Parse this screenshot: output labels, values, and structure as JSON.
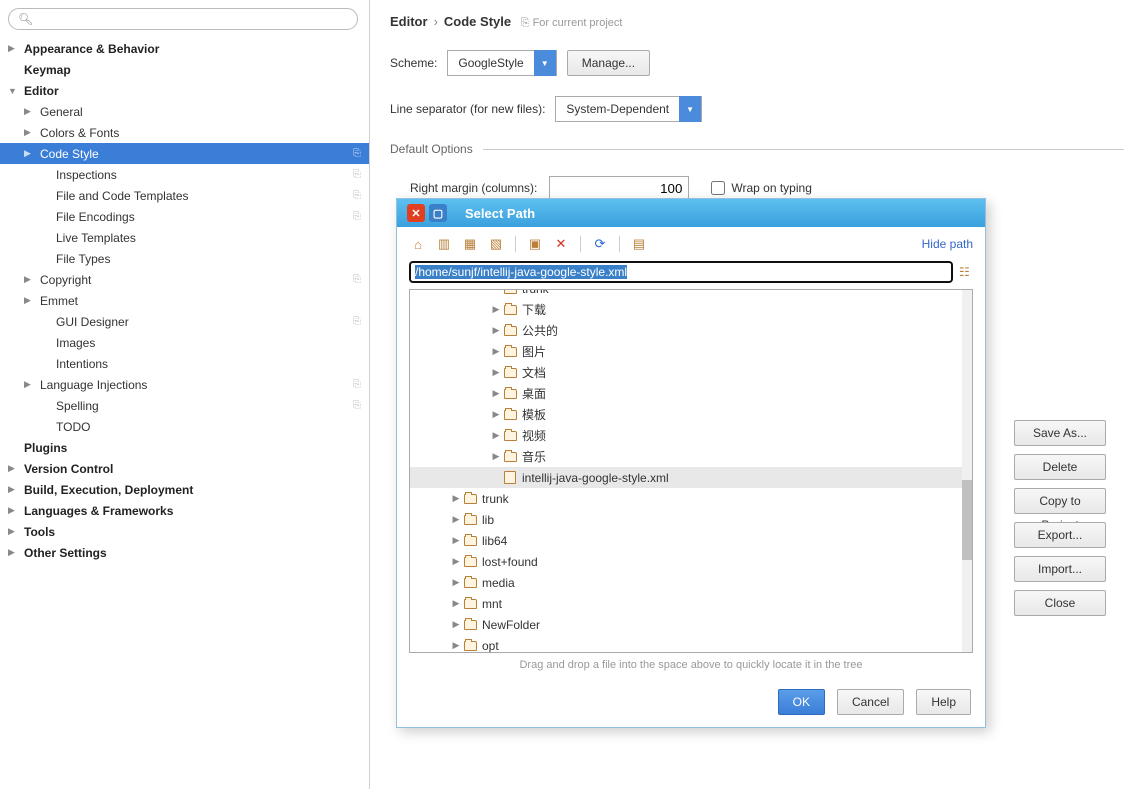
{
  "search": {
    "placeholder": ""
  },
  "tree": {
    "items": [
      {
        "label": "Appearance & Behavior",
        "bold": true,
        "arrow": "▶",
        "ind": 0
      },
      {
        "label": "Keymap",
        "bold": true,
        "arrow": "",
        "ind": 0
      },
      {
        "label": "Editor",
        "bold": true,
        "arrow": "▼",
        "ind": 0
      },
      {
        "label": "General",
        "arrow": "▶",
        "ind": 1
      },
      {
        "label": "Colors & Fonts",
        "arrow": "▶",
        "ind": 1
      },
      {
        "label": "Code Style",
        "arrow": "▶",
        "ind": 1,
        "selected": true,
        "copy": true
      },
      {
        "label": "Inspections",
        "arrow": "",
        "ind": 2,
        "copy": true
      },
      {
        "label": "File and Code Templates",
        "arrow": "",
        "ind": 2,
        "copy": true
      },
      {
        "label": "File Encodings",
        "arrow": "",
        "ind": 2,
        "copy": true
      },
      {
        "label": "Live Templates",
        "arrow": "",
        "ind": 2
      },
      {
        "label": "File Types",
        "arrow": "",
        "ind": 2
      },
      {
        "label": "Copyright",
        "arrow": "▶",
        "ind": 1,
        "copy": true
      },
      {
        "label": "Emmet",
        "arrow": "▶",
        "ind": 1
      },
      {
        "label": "GUI Designer",
        "arrow": "",
        "ind": 2,
        "copy": true
      },
      {
        "label": "Images",
        "arrow": "",
        "ind": 2
      },
      {
        "label": "Intentions",
        "arrow": "",
        "ind": 2
      },
      {
        "label": "Language Injections",
        "arrow": "▶",
        "ind": 1,
        "copy": true
      },
      {
        "label": "Spelling",
        "arrow": "",
        "ind": 2,
        "copy": true
      },
      {
        "label": "TODO",
        "arrow": "",
        "ind": 2
      },
      {
        "label": "Plugins",
        "bold": true,
        "arrow": "",
        "ind": 0
      },
      {
        "label": "Version Control",
        "bold": true,
        "arrow": "▶",
        "ind": 0
      },
      {
        "label": "Build, Execution, Deployment",
        "bold": true,
        "arrow": "▶",
        "ind": 0
      },
      {
        "label": "Languages & Frameworks",
        "bold": true,
        "arrow": "▶",
        "ind": 0
      },
      {
        "label": "Tools",
        "bold": true,
        "arrow": "▶",
        "ind": 0
      },
      {
        "label": "Other Settings",
        "bold": true,
        "arrow": "▶",
        "ind": 0
      }
    ]
  },
  "breadcrumb": {
    "a": "Editor",
    "b": "Code Style",
    "proj": "For current project"
  },
  "scheme": {
    "label": "Scheme:",
    "value": "GoogleStyle",
    "manage": "Manage..."
  },
  "lineSep": {
    "label": "Line separator (for new files):",
    "value": "System-Dependent"
  },
  "defaults": {
    "legend": "Default Options",
    "marginLabel": "Right margin (columns):",
    "marginValue": "100",
    "wrap": "Wrap on typing"
  },
  "schemeActions": [
    "Save As...",
    "Delete",
    "Copy to Project",
    "Export...",
    "Import...",
    "Close"
  ],
  "dialog": {
    "title": "Select Path",
    "hidePath": "Hide path",
    "pathValue": "/home/sunjf/intellij-java-google-style.xml",
    "hint": "Drag and drop a file into the space above to quickly locate it in the tree",
    "ok": "OK",
    "cancel": "Cancel",
    "help": "Help",
    "rows": [
      {
        "ind": 4,
        "arrow": "",
        "icon": "folder",
        "name": "trunk",
        "cut": true
      },
      {
        "ind": 4,
        "arrow": "▶",
        "icon": "folder",
        "name": "下载"
      },
      {
        "ind": 4,
        "arrow": "▶",
        "icon": "folder",
        "name": "公共的"
      },
      {
        "ind": 4,
        "arrow": "▶",
        "icon": "folder",
        "name": "图片"
      },
      {
        "ind": 4,
        "arrow": "▶",
        "icon": "folder",
        "name": "文档"
      },
      {
        "ind": 4,
        "arrow": "▶",
        "icon": "folder",
        "name": "桌面"
      },
      {
        "ind": 4,
        "arrow": "▶",
        "icon": "folder",
        "name": "模板"
      },
      {
        "ind": 4,
        "arrow": "▶",
        "icon": "folder",
        "name": "视频"
      },
      {
        "ind": 4,
        "arrow": "▶",
        "icon": "folder",
        "name": "音乐"
      },
      {
        "ind": 4,
        "arrow": "",
        "icon": "file",
        "name": "intellij-java-google-style.xml",
        "selected": true
      },
      {
        "ind": 2,
        "arrow": "▶",
        "icon": "folder",
        "name": "trunk"
      },
      {
        "ind": 2,
        "arrow": "▶",
        "icon": "folder",
        "name": "lib"
      },
      {
        "ind": 2,
        "arrow": "▶",
        "icon": "folder",
        "name": "lib64"
      },
      {
        "ind": 2,
        "arrow": "▶",
        "icon": "folder",
        "name": "lost+found"
      },
      {
        "ind": 2,
        "arrow": "▶",
        "icon": "folder",
        "name": "media"
      },
      {
        "ind": 2,
        "arrow": "▶",
        "icon": "folder",
        "name": "mnt"
      },
      {
        "ind": 2,
        "arrow": "▶",
        "icon": "folder",
        "name": "NewFolder"
      },
      {
        "ind": 2,
        "arrow": "▶",
        "icon": "folder",
        "name": "opt"
      }
    ]
  }
}
